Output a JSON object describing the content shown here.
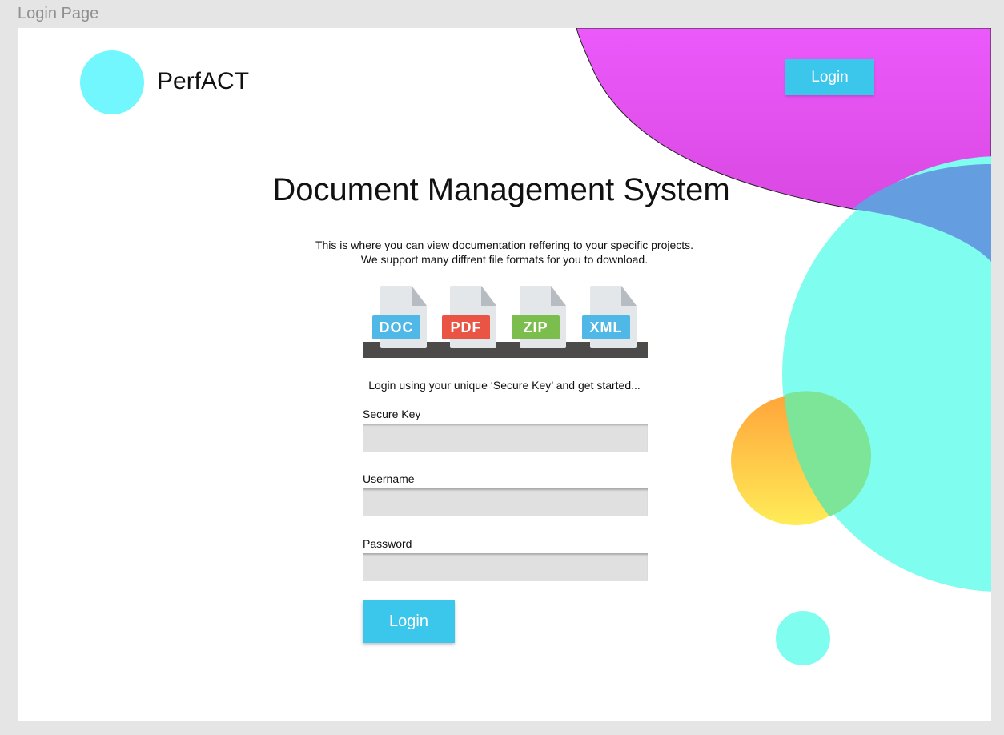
{
  "frame": {
    "label": "Login Page"
  },
  "header": {
    "brand": "PerfACT",
    "login_label": "Login"
  },
  "main": {
    "title": "Document Management System",
    "description": [
      "This is where you can view documentation reffering to your specific projects.",
      "We support many diffrent file formats for you to download."
    ],
    "file_formats": [
      {
        "label": "DOC",
        "color": "#4fb8e6",
        "icon": "doc-file-icon"
      },
      {
        "label": "PDF",
        "color": "#ea5445",
        "icon": "pdf-file-icon"
      },
      {
        "label": "ZIP",
        "color": "#7cbe4e",
        "icon": "zip-file-icon"
      },
      {
        "label": "XML",
        "color": "#4fb8e6",
        "icon": "xml-file-icon"
      }
    ]
  },
  "form": {
    "intro": "Login using your unique ‘Secure Key’ and get started...",
    "secure_key_label": "Secure Key",
    "secure_key_value": "",
    "username_label": "Username",
    "username_value": "",
    "password_label": "Password",
    "password_value": "",
    "submit_label": "Login"
  },
  "colors": {
    "accent": "#3bc6ec",
    "logo": "#72f7ff",
    "magenta_blob": "#e855f8",
    "cyan_blob": "#7ffdee",
    "orange_circle": "#ffa93d",
    "yellow_circle": "#ffe757"
  }
}
